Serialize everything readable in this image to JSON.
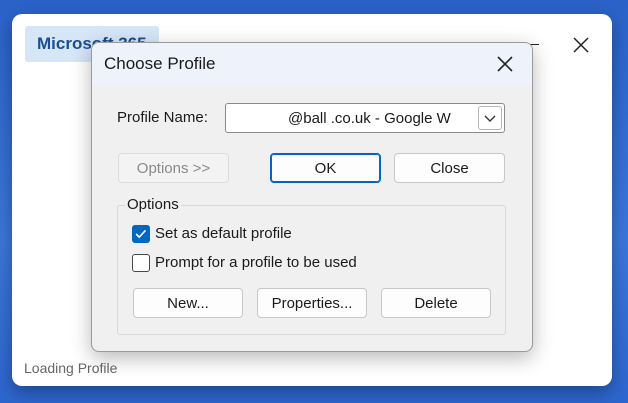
{
  "splash": {
    "brand": "Microsoft 365",
    "status": "Loading Profile"
  },
  "dialog": {
    "title": "Choose Profile",
    "profile_name_label": "Profile Name:",
    "profile_name_value": "@ball          .co.uk - Google W",
    "options_button": "Options >>",
    "ok_button": "OK",
    "close_button": "Close",
    "options_group_label": "Options",
    "set_default_label": "Set as default profile",
    "set_default_checked": true,
    "prompt_label": "Prompt for a profile to be used",
    "prompt_checked": false,
    "new_button": "New...",
    "properties_button": "Properties...",
    "delete_button": "Delete"
  }
}
